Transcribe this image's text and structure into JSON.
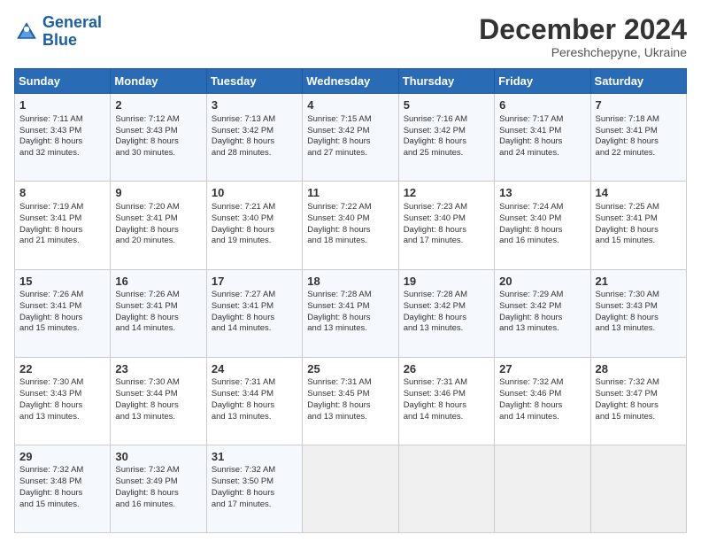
{
  "header": {
    "logo_line1": "General",
    "logo_line2": "Blue",
    "month": "December 2024",
    "location": "Pereshchepyne, Ukraine"
  },
  "weekdays": [
    "Sunday",
    "Monday",
    "Tuesday",
    "Wednesday",
    "Thursday",
    "Friday",
    "Saturday"
  ],
  "rows": [
    [
      {
        "day": "1",
        "lines": [
          "Sunrise: 7:11 AM",
          "Sunset: 3:43 PM",
          "Daylight: 8 hours",
          "and 32 minutes."
        ]
      },
      {
        "day": "2",
        "lines": [
          "Sunrise: 7:12 AM",
          "Sunset: 3:43 PM",
          "Daylight: 8 hours",
          "and 30 minutes."
        ]
      },
      {
        "day": "3",
        "lines": [
          "Sunrise: 7:13 AM",
          "Sunset: 3:42 PM",
          "Daylight: 8 hours",
          "and 28 minutes."
        ]
      },
      {
        "day": "4",
        "lines": [
          "Sunrise: 7:15 AM",
          "Sunset: 3:42 PM",
          "Daylight: 8 hours",
          "and 27 minutes."
        ]
      },
      {
        "day": "5",
        "lines": [
          "Sunrise: 7:16 AM",
          "Sunset: 3:42 PM",
          "Daylight: 8 hours",
          "and 25 minutes."
        ]
      },
      {
        "day": "6",
        "lines": [
          "Sunrise: 7:17 AM",
          "Sunset: 3:41 PM",
          "Daylight: 8 hours",
          "and 24 minutes."
        ]
      },
      {
        "day": "7",
        "lines": [
          "Sunrise: 7:18 AM",
          "Sunset: 3:41 PM",
          "Daylight: 8 hours",
          "and 22 minutes."
        ]
      }
    ],
    [
      {
        "day": "8",
        "lines": [
          "Sunrise: 7:19 AM",
          "Sunset: 3:41 PM",
          "Daylight: 8 hours",
          "and 21 minutes."
        ]
      },
      {
        "day": "9",
        "lines": [
          "Sunrise: 7:20 AM",
          "Sunset: 3:41 PM",
          "Daylight: 8 hours",
          "and 20 minutes."
        ]
      },
      {
        "day": "10",
        "lines": [
          "Sunrise: 7:21 AM",
          "Sunset: 3:40 PM",
          "Daylight: 8 hours",
          "and 19 minutes."
        ]
      },
      {
        "day": "11",
        "lines": [
          "Sunrise: 7:22 AM",
          "Sunset: 3:40 PM",
          "Daylight: 8 hours",
          "and 18 minutes."
        ]
      },
      {
        "day": "12",
        "lines": [
          "Sunrise: 7:23 AM",
          "Sunset: 3:40 PM",
          "Daylight: 8 hours",
          "and 17 minutes."
        ]
      },
      {
        "day": "13",
        "lines": [
          "Sunrise: 7:24 AM",
          "Sunset: 3:40 PM",
          "Daylight: 8 hours",
          "and 16 minutes."
        ]
      },
      {
        "day": "14",
        "lines": [
          "Sunrise: 7:25 AM",
          "Sunset: 3:41 PM",
          "Daylight: 8 hours",
          "and 15 minutes."
        ]
      }
    ],
    [
      {
        "day": "15",
        "lines": [
          "Sunrise: 7:26 AM",
          "Sunset: 3:41 PM",
          "Daylight: 8 hours",
          "and 15 minutes."
        ]
      },
      {
        "day": "16",
        "lines": [
          "Sunrise: 7:26 AM",
          "Sunset: 3:41 PM",
          "Daylight: 8 hours",
          "and 14 minutes."
        ]
      },
      {
        "day": "17",
        "lines": [
          "Sunrise: 7:27 AM",
          "Sunset: 3:41 PM",
          "Daylight: 8 hours",
          "and 14 minutes."
        ]
      },
      {
        "day": "18",
        "lines": [
          "Sunrise: 7:28 AM",
          "Sunset: 3:41 PM",
          "Daylight: 8 hours",
          "and 13 minutes."
        ]
      },
      {
        "day": "19",
        "lines": [
          "Sunrise: 7:28 AM",
          "Sunset: 3:42 PM",
          "Daylight: 8 hours",
          "and 13 minutes."
        ]
      },
      {
        "day": "20",
        "lines": [
          "Sunrise: 7:29 AM",
          "Sunset: 3:42 PM",
          "Daylight: 8 hours",
          "and 13 minutes."
        ]
      },
      {
        "day": "21",
        "lines": [
          "Sunrise: 7:30 AM",
          "Sunset: 3:43 PM",
          "Daylight: 8 hours",
          "and 13 minutes."
        ]
      }
    ],
    [
      {
        "day": "22",
        "lines": [
          "Sunrise: 7:30 AM",
          "Sunset: 3:43 PM",
          "Daylight: 8 hours",
          "and 13 minutes."
        ]
      },
      {
        "day": "23",
        "lines": [
          "Sunrise: 7:30 AM",
          "Sunset: 3:44 PM",
          "Daylight: 8 hours",
          "and 13 minutes."
        ]
      },
      {
        "day": "24",
        "lines": [
          "Sunrise: 7:31 AM",
          "Sunset: 3:44 PM",
          "Daylight: 8 hours",
          "and 13 minutes."
        ]
      },
      {
        "day": "25",
        "lines": [
          "Sunrise: 7:31 AM",
          "Sunset: 3:45 PM",
          "Daylight: 8 hours",
          "and 13 minutes."
        ]
      },
      {
        "day": "26",
        "lines": [
          "Sunrise: 7:31 AM",
          "Sunset: 3:46 PM",
          "Daylight: 8 hours",
          "and 14 minutes."
        ]
      },
      {
        "day": "27",
        "lines": [
          "Sunrise: 7:32 AM",
          "Sunset: 3:46 PM",
          "Daylight: 8 hours",
          "and 14 minutes."
        ]
      },
      {
        "day": "28",
        "lines": [
          "Sunrise: 7:32 AM",
          "Sunset: 3:47 PM",
          "Daylight: 8 hours",
          "and 15 minutes."
        ]
      }
    ],
    [
      {
        "day": "29",
        "lines": [
          "Sunrise: 7:32 AM",
          "Sunset: 3:48 PM",
          "Daylight: 8 hours",
          "and 15 minutes."
        ]
      },
      {
        "day": "30",
        "lines": [
          "Sunrise: 7:32 AM",
          "Sunset: 3:49 PM",
          "Daylight: 8 hours",
          "and 16 minutes."
        ]
      },
      {
        "day": "31",
        "lines": [
          "Sunrise: 7:32 AM",
          "Sunset: 3:50 PM",
          "Daylight: 8 hours",
          "and 17 minutes."
        ]
      },
      null,
      null,
      null,
      null
    ]
  ]
}
